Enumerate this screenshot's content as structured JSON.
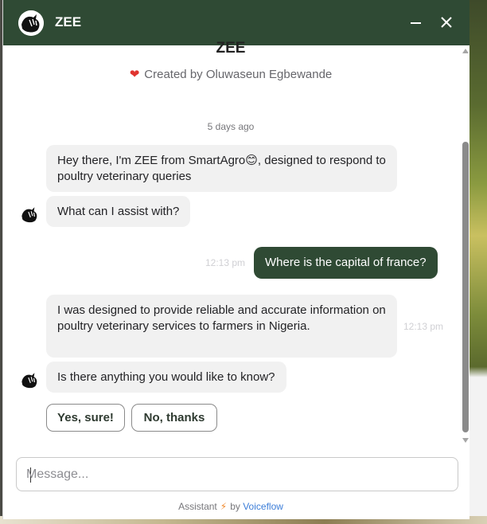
{
  "header": {
    "title": "ZEE",
    "minimize_icon": "minus-icon",
    "close_icon": "close-icon"
  },
  "agent": {
    "name": "ZEE",
    "creator_text": "Created by Oluwaseun Egbewande",
    "heart_icon": "heart-icon"
  },
  "conversation": {
    "day_label": "5 days ago",
    "messages": [
      {
        "from": "bot",
        "text": "Hey there, I'm ZEE from SmartAgro😊, designed to respond to poultry veterinary queries"
      },
      {
        "from": "bot",
        "text": "What can I assist with?"
      },
      {
        "from": "user",
        "text": "Where is the capital of france?",
        "time": "12:13 pm"
      },
      {
        "from": "bot",
        "text": "I was designed to provide reliable and accurate information on poultry veterinary services to farmers in Nigeria.",
        "time": "12:13 pm"
      },
      {
        "from": "bot",
        "text": "Is there anything you would like to know?"
      }
    ],
    "choices": [
      "Yes, sure!",
      "No, thanks"
    ]
  },
  "composer": {
    "placeholder": "Message...",
    "value": ""
  },
  "footer": {
    "prefix": "Assistant",
    "by": "by",
    "brand": "Voiceflow"
  },
  "colors": {
    "brand": "#2f4a34",
    "bubble_bg": "#f1f1f1",
    "heart": "#e0342f",
    "bolt": "#f18a2b",
    "link": "#3b7dd8"
  }
}
